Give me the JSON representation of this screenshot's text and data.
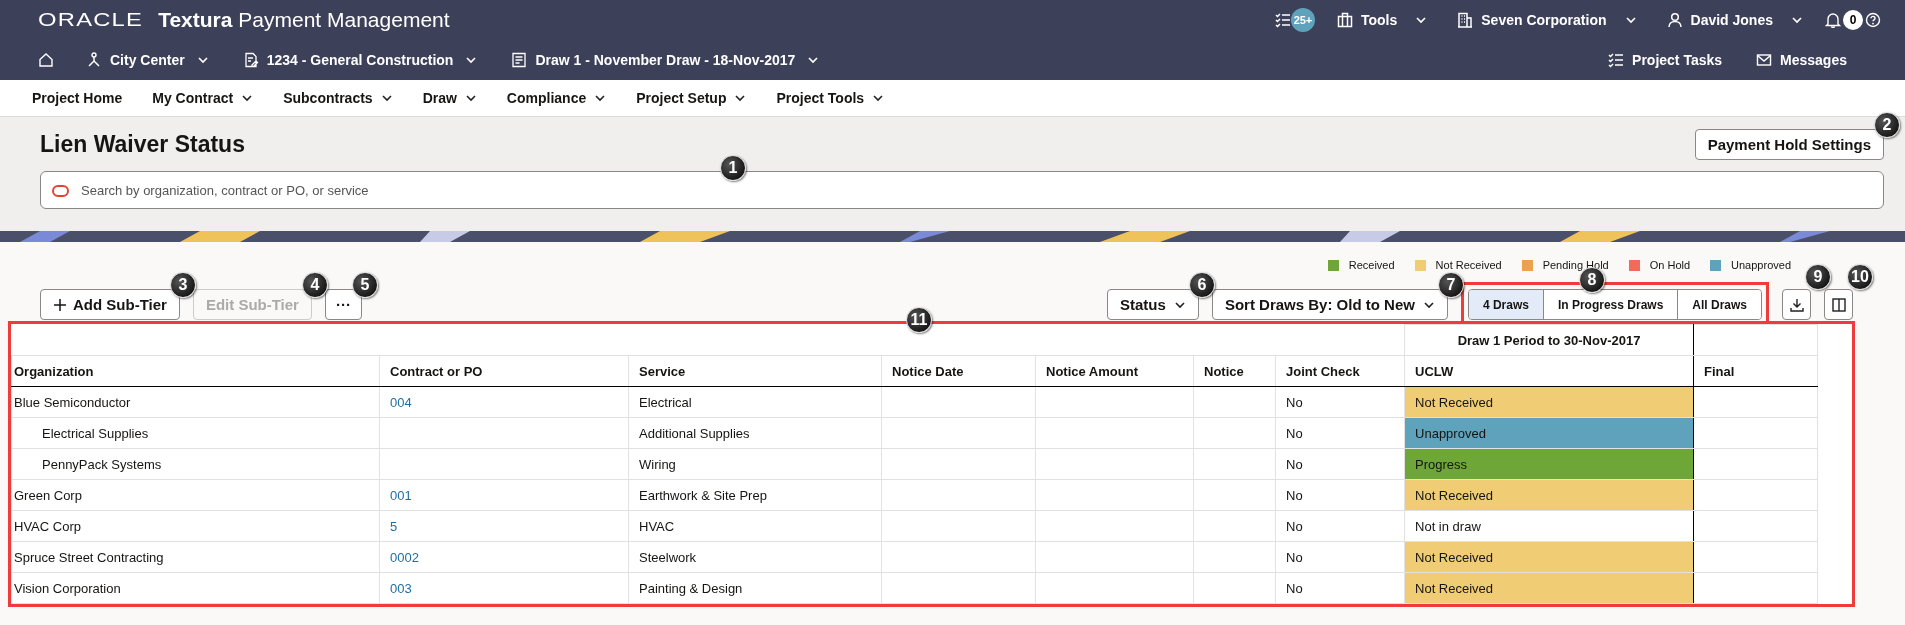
{
  "topbar": {
    "brand": "ORACLE",
    "product_bold": "Textura",
    "product": "Payment Management",
    "tasks_badge": "25+",
    "tools": "Tools",
    "company": "Seven Corporation",
    "user": "David Jones",
    "notification_badge": "0",
    "breadcrumbs": [
      "City Center",
      "1234 - General Construction",
      "Draw 1 - November Draw - 18-Nov-2017"
    ],
    "links": [
      "Project Tasks",
      "Messages"
    ]
  },
  "nav": [
    {
      "label": "Project Home",
      "has_menu": false
    },
    {
      "label": "My Contract",
      "has_menu": true
    },
    {
      "label": "Subcontracts",
      "has_menu": true
    },
    {
      "label": "Draw",
      "has_menu": true
    },
    {
      "label": "Compliance",
      "has_menu": true
    },
    {
      "label": "Project Setup",
      "has_menu": true
    },
    {
      "label": "Project Tools",
      "has_menu": true
    }
  ],
  "page": {
    "title": "Lien Waiver Status",
    "hold_button": {
      "label": "Payment Hold Settings",
      "callout": "2"
    },
    "search": {
      "placeholder": "Search by organization, contract or PO, or service",
      "callout": "1"
    }
  },
  "toolbar": {
    "add": {
      "label": "Add Sub-Tier",
      "disabled": false,
      "callout": "3"
    },
    "edit": {
      "label": "Edit Sub-Tier",
      "disabled": true,
      "callout": "4"
    },
    "more": {
      "label": "···",
      "callout": "5"
    },
    "legend": [
      {
        "label": "Received",
        "color": "#6ea737"
      },
      {
        "label": "Not Received",
        "color": "#f0cd74"
      },
      {
        "label": "Pending Hold",
        "color": "#eca24c"
      },
      {
        "label": "On Hold",
        "color": "#f36a5a"
      },
      {
        "label": "Unapproved",
        "color": "#5fa2bc"
      }
    ],
    "status": {
      "label": "Status",
      "callout": "6"
    },
    "sort": {
      "label": "Sort Draws By: Old to New",
      "callout": "7"
    },
    "draw_filters": {
      "callout": "8",
      "highlighted": true,
      "options": [
        {
          "label": "4 Draws",
          "selected": true
        },
        {
          "label": "In Progress Draws",
          "selected": false
        },
        {
          "label": "All Draws",
          "selected": false
        }
      ]
    },
    "export": {
      "callout": "9"
    },
    "columns": {
      "callout": "10"
    }
  },
  "table": {
    "callout": "11",
    "highlighted": true,
    "group_header": "Draw 1 Period to 30-Nov-2017",
    "columns": [
      "Organization",
      "Contract or PO",
      "Service",
      "Notice Date",
      "Notice Amount",
      "Notice",
      "Joint Check",
      "UCLW",
      "Final"
    ],
    "rows": [
      {
        "organization": "Blue Semiconductor",
        "contract": "004",
        "service": "Electrical",
        "joint_check": "No",
        "uclw": {
          "text": "Not Received",
          "color": "#f0cd74"
        },
        "children": [
          {
            "organization": "Electrical Supplies",
            "service": "Additional Supplies",
            "joint_check": "No",
            "uclw": {
              "text": "Unapproved",
              "color": "#5fa2bc"
            }
          },
          {
            "organization": "PennyPack Systems",
            "service": "Wiring",
            "joint_check": "No",
            "uclw": {
              "text": "Progress",
              "color": "#6ea737"
            }
          }
        ]
      },
      {
        "organization": "Green Corp",
        "contract": "001",
        "service": "Earthwork & Site Prep",
        "joint_check": "No",
        "uclw": {
          "text": "Not Received",
          "color": "#f0cd74"
        }
      },
      {
        "organization": "HVAC Corp",
        "contract": "5",
        "service": "HVAC",
        "joint_check": "No",
        "uclw": {
          "text": "Not in draw",
          "color": "#ffffff"
        }
      },
      {
        "organization": "Spruce Street Contracting",
        "contract": "0002",
        "service": "Steelwork",
        "joint_check": "No",
        "uclw": {
          "text": "Not Received",
          "color": "#f0cd74"
        }
      },
      {
        "organization": "Vision Corporation",
        "contract": "003",
        "service": "Painting & Design",
        "joint_check": "No",
        "uclw": {
          "text": "Not Received",
          "color": "#f0cd74"
        }
      }
    ]
  }
}
